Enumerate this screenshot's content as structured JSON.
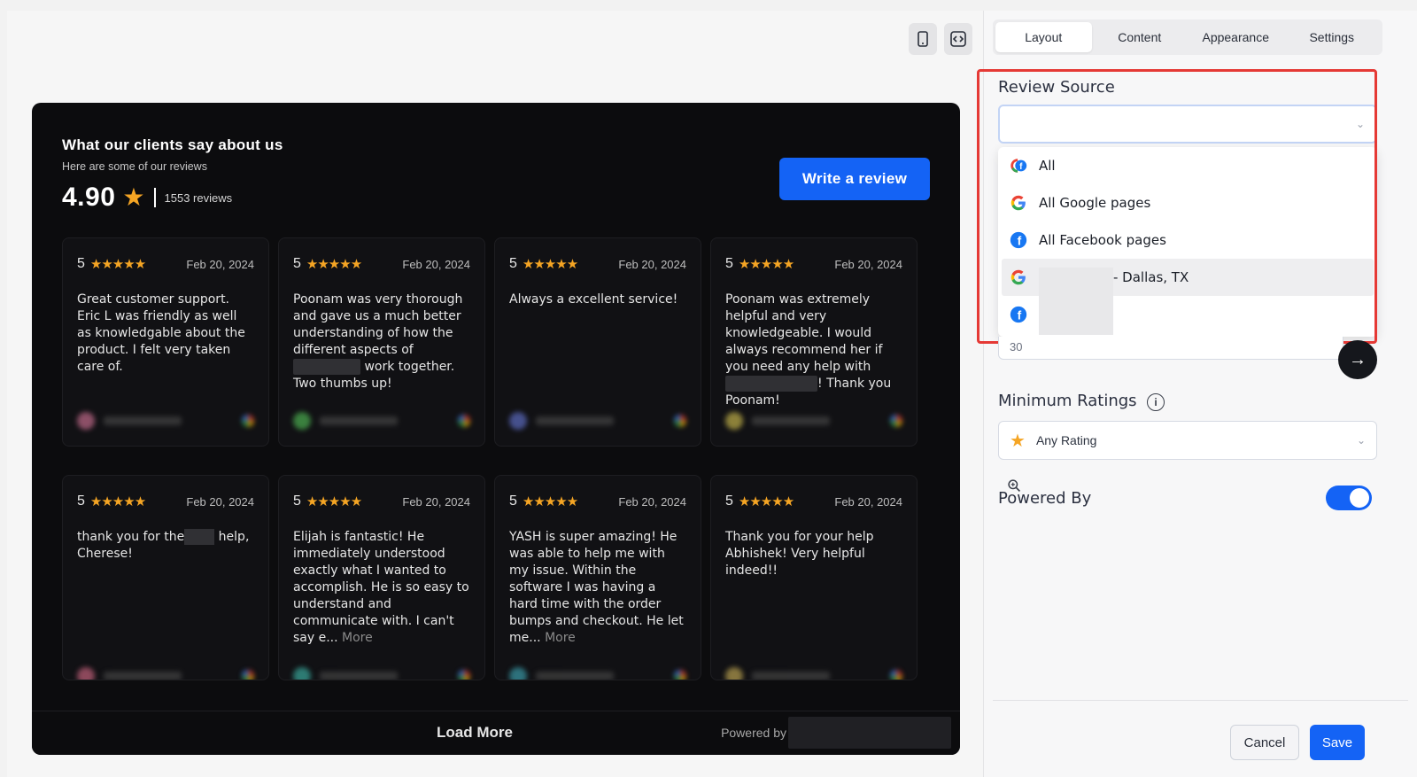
{
  "preview": {
    "widget": {
      "title": "What our clients say about us",
      "subtitle": "Here are some of our reviews",
      "score": "4.90",
      "review_count": "1553 reviews",
      "write_review_label": "Write a review",
      "load_more_label": "Load More",
      "powered_by_label": "Powered by"
    },
    "cards": [
      {
        "rating": "5",
        "date": "Feb 20, 2024",
        "text": "Great customer support. Eric L was friendly as well as knowledgable about the product. I felt very taken care of.",
        "avatar_color": "#c06a8a"
      },
      {
        "rating": "5",
        "date": "Feb 20, 2024",
        "text_a": "Poonam was very thorough and gave us a much better understanding of how the different aspects of",
        "text_b": " work together. Two thumbs up!",
        "avatar_color": "#4caf50"
      },
      {
        "rating": "5",
        "date": "Feb 20, 2024",
        "text": "Always a excellent service!",
        "avatar_color": "#5c6bc0"
      },
      {
        "rating": "5",
        "date": "Feb 20, 2024",
        "text_a": "Poonam was extremely helpful and very knowledgeable. I would always recommend her if you need any help with",
        "text_b": "! Thank you Poonam!",
        "avatar_color": "#c0b04a"
      },
      {
        "rating": "5",
        "date": "Feb 20, 2024",
        "text_a": "thank you for the",
        "text_b": " help, Cherese!",
        "avatar_color": "#c0607a"
      },
      {
        "rating": "5",
        "date": "Feb 20, 2024",
        "text": "Elijah is fantastic! He immediately understood exactly what I wanted to accomplish. He is so easy to understand and communicate with. I can't say e...",
        "more": "More",
        "avatar_color": "#3aa89c"
      },
      {
        "rating": "5",
        "date": "Feb 20, 2024",
        "text": "YASH is super amazing! He was able to help me with my issue. Within the software I was having a hard time with the order bumps and checkout. He let me...",
        "more": "More",
        "avatar_color": "#3a9aa8"
      },
      {
        "rating": "5",
        "date": "Feb 20, 2024",
        "text": "Thank you for your help Abhishek! Very helpful indeed!!",
        "avatar_color": "#b8a050"
      }
    ],
    "stars": "★★★★★",
    "star_char": "★"
  },
  "panel": {
    "tabs": [
      "Layout",
      "Content",
      "Appearance",
      "Settings"
    ],
    "active_tab": "Layout",
    "review_source": {
      "label": "Review Source",
      "value": "",
      "options": [
        {
          "label": "All",
          "icon": "google-facebook-combined-icon"
        },
        {
          "label": "All Google pages",
          "icon": "google-icon"
        },
        {
          "label": "All Facebook pages",
          "icon": "facebook-icon"
        },
        {
          "label": "- Dallas, TX",
          "icon": "google-icon"
        },
        {
          "label": "",
          "icon": "facebook-icon"
        }
      ]
    },
    "hidden_field_value": "30",
    "minimum_ratings": {
      "label": "Minimum Ratings",
      "value": "Any Rating"
    },
    "powered_by": {
      "label": "Powered By",
      "enabled": true
    },
    "cancel_label": "Cancel",
    "save_label": "Save"
  },
  "colors": {
    "accent": "#1463f5",
    "star": "#f5a524",
    "highlight": "#e53935",
    "widget_bg": "#0c0c0e"
  }
}
